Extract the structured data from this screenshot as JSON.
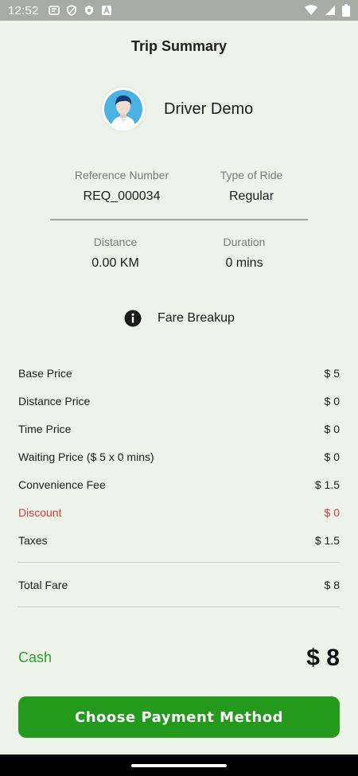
{
  "status": {
    "time": "12:52",
    "left_icons": [
      "translate-icon",
      "shield-icon",
      "shield-filled-icon",
      "a-icon"
    ],
    "right_icons": [
      "wifi-icon",
      "signal-icon",
      "battery-icon"
    ]
  },
  "header": {
    "title": "Trip Summary"
  },
  "driver": {
    "name": "Driver Demo"
  },
  "trip": {
    "reference_label": "Reference Number",
    "reference_value": "REQ_000034",
    "ride_type_label": "Type of Ride",
    "ride_type_value": "Regular",
    "distance_label": "Distance",
    "distance_value": "0.00 KM",
    "duration_label": "Duration",
    "duration_value": "0 mins"
  },
  "fare": {
    "heading": "Fare Breakup",
    "rows": [
      {
        "label": "Base Price",
        "value": "$ 5"
      },
      {
        "label": "Distance Price",
        "value": "$ 0"
      },
      {
        "label": "Time Price",
        "value": "$ 0"
      },
      {
        "label": "Waiting Price ($ 5 x 0 mins)",
        "value": "$ 0"
      },
      {
        "label": "Convenience Fee",
        "value": "$ 1.5"
      },
      {
        "label": "Discount",
        "value": "$ 0"
      },
      {
        "label": "Taxes",
        "value": "$ 1.5"
      }
    ],
    "total_label": "Total Fare",
    "total_value": "$ 8"
  },
  "payment": {
    "method": "Cash",
    "amount": "$ 8",
    "button_label": "Choose Payment Method"
  },
  "colors": {
    "background": "#eef3ea",
    "accent_green": "#249a1d",
    "discount_red": "#d83a3a"
  }
}
